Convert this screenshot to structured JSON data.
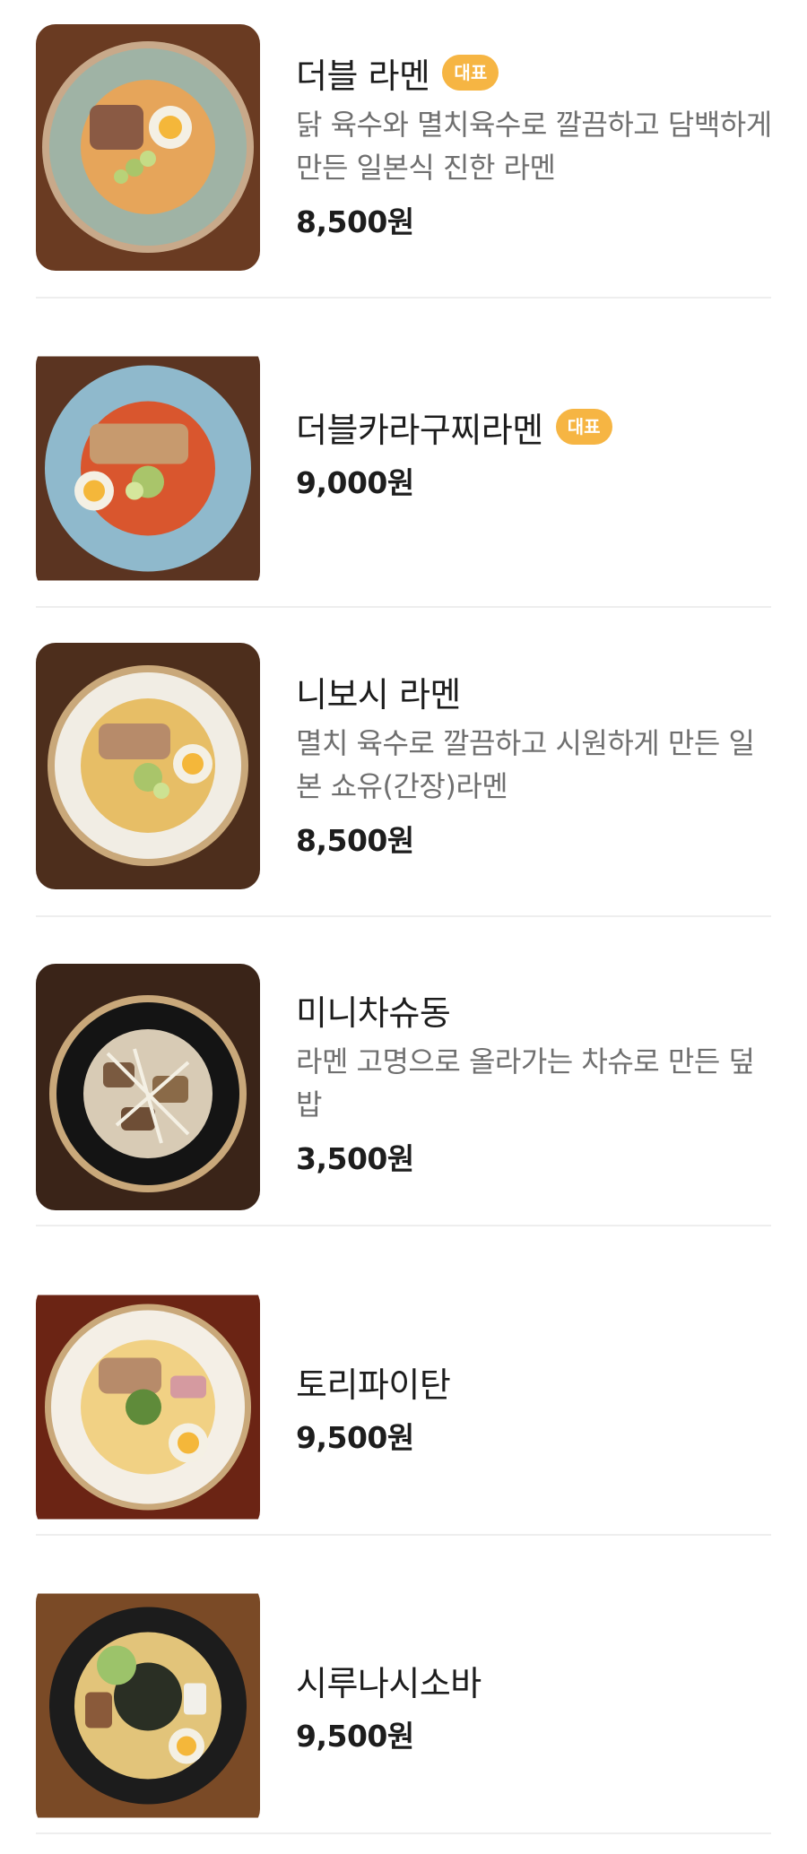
{
  "menu": {
    "items": [
      {
        "name": "더블 라멘",
        "badge": "대표",
        "desc": "닭 육수와 멸치육수로 깔끔하고 담백하게 만든 일본식 진한 라멘",
        "price": "8,500원",
        "bowl_color": "#9fb3a5",
        "broth_color": "#e6a55a",
        "table_color": "#6a3b22"
      },
      {
        "name": "더블카라구찌라멘",
        "badge": "대표",
        "desc": "",
        "price": "9,000원",
        "bowl_color": "#8fb9cc",
        "broth_color": "#d9562e",
        "table_color": "#5b3421"
      },
      {
        "name": "니보시 라멘",
        "badge": "",
        "desc": "멸치 육수로 깔끔하고 시원하게 만든 일본 쇼유(간장)라멘",
        "price": "8,500원",
        "bowl_color": "#f1ede4",
        "broth_color": "#e7be66",
        "table_color": "#4d2e1c"
      },
      {
        "name": "미니차슈동",
        "badge": "",
        "desc": "라멘 고명으로 올라가는 차슈로 만든 덮밥",
        "price": "3,500원",
        "bowl_color": "#141414",
        "broth_color": "#d8cbb5",
        "table_color": "#3a2418"
      },
      {
        "name": "토리파이탄",
        "badge": "",
        "desc": "",
        "price": "9,500원",
        "bowl_color": "#f4efe6",
        "broth_color": "#f1d184",
        "table_color": "#6b2414"
      },
      {
        "name": "시루나시소바",
        "badge": "",
        "desc": "",
        "price": "9,500원",
        "bowl_color": "#1c1c1c",
        "broth_color": "#e2c47a",
        "table_color": "#7a4a26"
      }
    ]
  }
}
